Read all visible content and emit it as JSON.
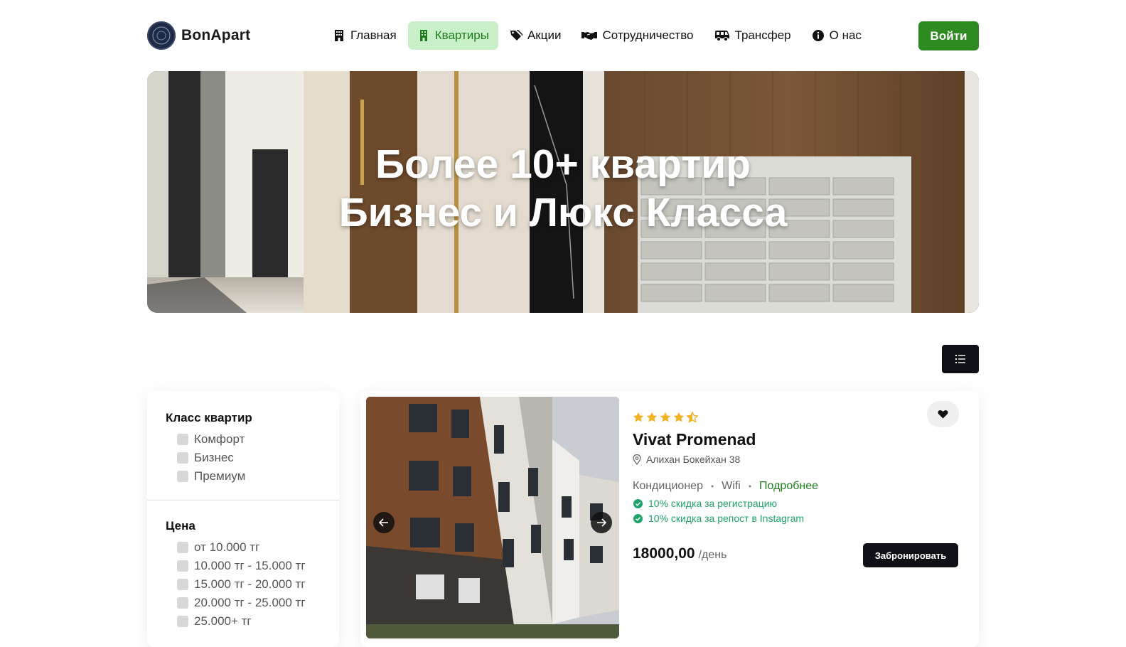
{
  "header": {
    "logo_text": "BonApart",
    "nav": [
      {
        "label": "Главная",
        "icon": "building-icon"
      },
      {
        "label": "Квартиры",
        "icon": "apartment-icon",
        "active": true
      },
      {
        "label": "Акции",
        "icon": "tags-icon"
      },
      {
        "label": "Сотрудничество",
        "icon": "handshake-icon"
      },
      {
        "label": "Трансфер",
        "icon": "van-icon"
      },
      {
        "label": "О нас",
        "icon": "info-icon"
      }
    ],
    "login_label": "Войти"
  },
  "hero": {
    "line1": "Более 10+ квартир",
    "line2": "Бизнес и Люкс Класса"
  },
  "filters": {
    "class_title": "Класс квартир",
    "class_options": [
      "Комфорт",
      "Бизнес",
      "Премиум"
    ],
    "price_title": "Цена",
    "price_options": [
      "от 10.000 тг",
      "10.000 тг - 15.000 тг",
      "15.000 тг - 20.000 тг",
      "20.000 тг - 25.000 тг",
      "25.000+ тг"
    ]
  },
  "listing": {
    "rating": 4.5,
    "name": "Vivat Promenad",
    "address": "Алихан Бокейхан 38",
    "amenities": [
      "Кондиционер",
      "Wifi"
    ],
    "details_label": "Подробнее",
    "promos": [
      "10% скидка за регистрацию",
      "10% скидка за репост в Instagram"
    ],
    "price": "18000,00",
    "price_unit": "/день",
    "book_label": "Забронировать"
  },
  "colors": {
    "brand_green": "#2e8b22",
    "active_nav_bg": "#c9f0c9",
    "promo_green": "#1fa36a",
    "star_gold": "#f0b323",
    "dark": "#0f1117"
  }
}
